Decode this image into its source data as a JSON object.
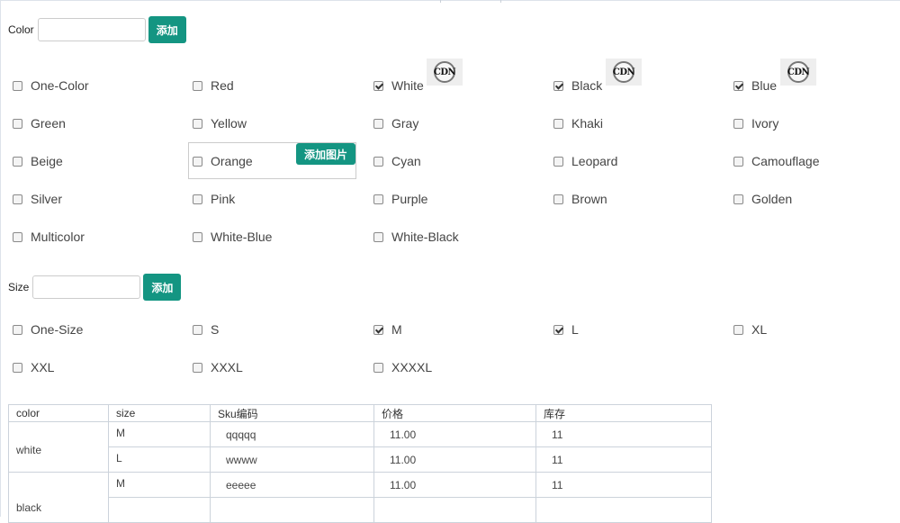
{
  "color_section": {
    "label": "Color",
    "input_value": "",
    "add_button": "添加",
    "options": [
      {
        "label": "One-Color",
        "checked": false
      },
      {
        "label": "Red",
        "checked": false
      },
      {
        "label": "White",
        "checked": true,
        "image": "CDN"
      },
      {
        "label": "Black",
        "checked": true,
        "image": "CDN"
      },
      {
        "label": "Blue",
        "checked": true,
        "image": "CDN"
      },
      {
        "label": "Green",
        "checked": false
      },
      {
        "label": "Yellow",
        "checked": false
      },
      {
        "label": "Gray",
        "checked": false
      },
      {
        "label": "Khaki",
        "checked": false
      },
      {
        "label": "Ivory",
        "checked": false
      },
      {
        "label": "Beige",
        "checked": false
      },
      {
        "label": "Orange",
        "checked": false
      },
      {
        "label": "Cyan",
        "checked": false
      },
      {
        "label": "Leopard",
        "checked": false
      },
      {
        "label": "Camouflage",
        "checked": false
      },
      {
        "label": "Silver",
        "checked": false
      },
      {
        "label": "Pink",
        "checked": false
      },
      {
        "label": "Purple",
        "checked": false
      },
      {
        "label": "Brown",
        "checked": false
      },
      {
        "label": "Golden",
        "checked": false
      },
      {
        "label": "Multicolor",
        "checked": false
      },
      {
        "label": "White-Blue",
        "checked": false
      },
      {
        "label": "White-Black",
        "checked": false
      }
    ],
    "add_image_button": "添加图片"
  },
  "size_section": {
    "label": "Size",
    "input_value": "",
    "add_button": "添加",
    "options": [
      {
        "label": "One-Size",
        "checked": false
      },
      {
        "label": "S",
        "checked": false
      },
      {
        "label": "M",
        "checked": true
      },
      {
        "label": "L",
        "checked": true
      },
      {
        "label": "XL",
        "checked": false
      },
      {
        "label": "XXL",
        "checked": false
      },
      {
        "label": "XXXL",
        "checked": false
      },
      {
        "label": "XXXXL",
        "checked": false
      }
    ]
  },
  "sku_table": {
    "headers": [
      "color",
      "size",
      "Sku编码",
      "价格",
      "库存"
    ],
    "groups": [
      {
        "color": "white",
        "rows": [
          {
            "size": "M",
            "sku": "qqqqq",
            "price": "11.00",
            "stock": "11"
          },
          {
            "size": "L",
            "sku": "wwww",
            "price": "11.00",
            "stock": "11"
          }
        ]
      },
      {
        "color": "black",
        "rows": [
          {
            "size": "M",
            "sku": "eeeee",
            "price": "11.00",
            "stock": "11"
          }
        ]
      }
    ]
  },
  "theme": {
    "accent": "#149582",
    "border": "#ccd3db"
  }
}
